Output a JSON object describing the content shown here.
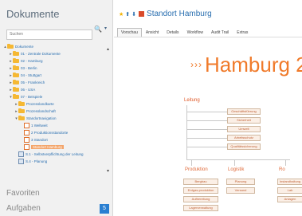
{
  "sidebar": {
    "title": "Dokumente",
    "search_placeholder": "Suchen",
    "tree": [
      {
        "label": "Dokumente",
        "level": 0,
        "icon": "folder-icon",
        "toggle": "▴"
      },
      {
        "label": "01 - Zentrale Dokumente",
        "level": 1,
        "icon": "folder-icon",
        "toggle": "▸"
      },
      {
        "label": "02 - Hamburg",
        "level": 1,
        "icon": "folder-icon",
        "toggle": "▸"
      },
      {
        "label": "03 - Berlin",
        "level": 1,
        "icon": "folder-icon",
        "toggle": "▸"
      },
      {
        "label": "04 - Stuttgart",
        "level": 1,
        "icon": "folder-icon",
        "toggle": "▸"
      },
      {
        "label": "05 - Frankreich",
        "level": 1,
        "icon": "folder-icon",
        "toggle": "▸"
      },
      {
        "label": "06 - USA",
        "level": 1,
        "icon": "folder-icon",
        "toggle": "▸"
      },
      {
        "label": "07 - Beispiele",
        "level": 1,
        "icon": "folder-icon",
        "toggle": "▾"
      },
      {
        "label": "Prozesslandkarte",
        "level": 2,
        "icon": "folder-icon",
        "toggle": "▸"
      },
      {
        "label": "Prozesslandschaft",
        "level": 2,
        "icon": "folder-icon",
        "toggle": "▸"
      },
      {
        "label": "Standortnavigation",
        "level": 2,
        "icon": "folder-icon",
        "toggle": "▾"
      },
      {
        "label": "1 Weltweit",
        "level": 3,
        "icon": "page-icon",
        "toggle": ""
      },
      {
        "label": "2 Produktionsstandorte",
        "level": 3,
        "icon": "page-icon",
        "toggle": ""
      },
      {
        "label": "3 Standort",
        "level": 3,
        "icon": "page-icon",
        "toggle": ""
      },
      {
        "label": "Standort Hamburg",
        "level": 3,
        "icon": "page-icon",
        "toggle": "",
        "selected": true
      },
      {
        "label": "S.1 - Selbstverpflichtung der Leitung",
        "level": 2,
        "icon": "page-blue-icon",
        "toggle": ""
      },
      {
        "label": "S.4 - Planung",
        "level": 2,
        "icon": "page-blue-icon",
        "toggle": ""
      }
    ],
    "sections": [
      "Favoriten",
      "Aufgaben"
    ],
    "aufgaben_badge": "5"
  },
  "main": {
    "breadcrumb_icons": [
      "star-icon",
      "up-icon",
      "down-icon"
    ],
    "title": "Standort Hamburg",
    "tabs": [
      "Vorschau",
      "Ansicht",
      "Details",
      "Workflow",
      "Audit Trail",
      "Extras"
    ],
    "active_tab": 0,
    "arrows": "›››",
    "big_title": "Hamburg 2",
    "leitung_label": "Leitung",
    "leitung_boxes": [
      "Geschäftsführung",
      "Sicherheit",
      "Umwelt",
      "Arbeitsschutz",
      "Qualitätssicherung"
    ],
    "columns": [
      {
        "label": "Produktion",
        "boxes": [
          "Bergbau",
          "Erdgas-produktion",
          "Aufbereitung",
          "Lagerverwaltung"
        ]
      },
      {
        "label": "Logistik",
        "boxes": [
          "Planung",
          "Versand"
        ]
      },
      {
        "label": "Ro",
        "boxes": [
          "Instandhaltung",
          "Lab",
          "Anlagen"
        ]
      }
    ],
    "accent_color": "#f07a2a"
  }
}
